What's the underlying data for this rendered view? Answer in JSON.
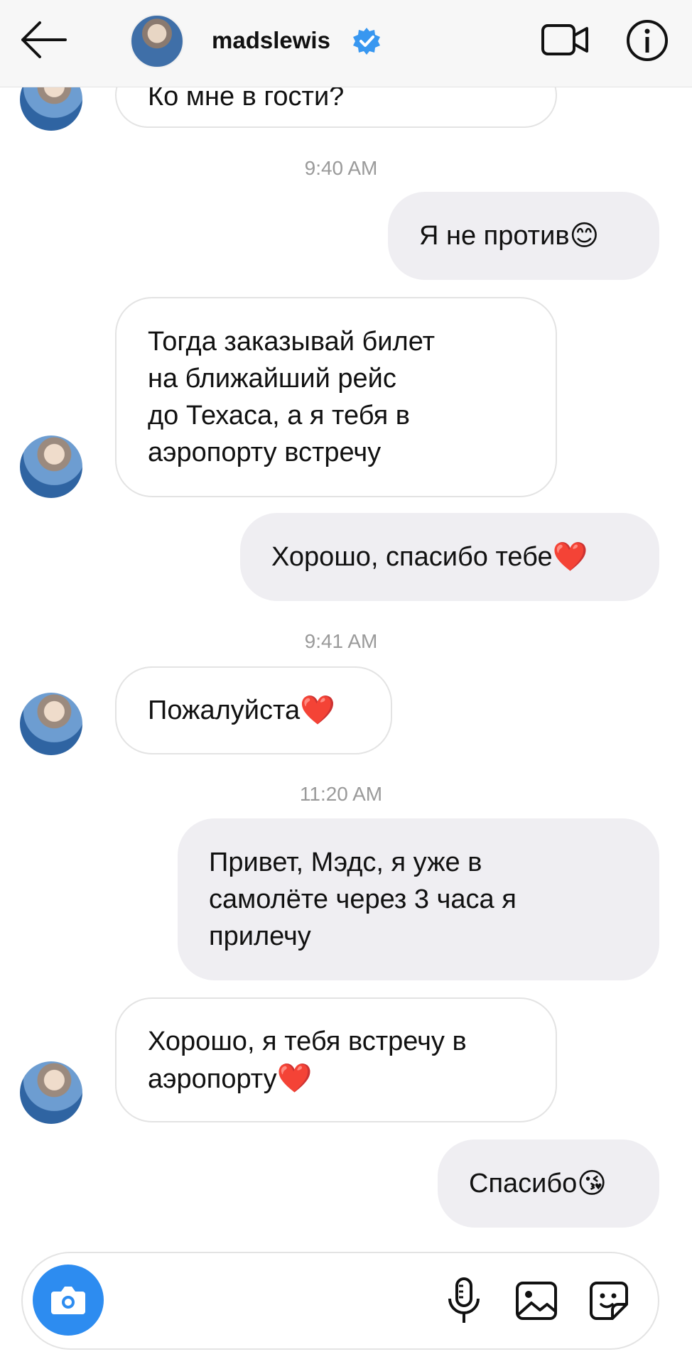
{
  "header": {
    "username": "madslewis",
    "icons": {
      "back": "back-arrow-icon",
      "verified": "verified-badge-icon",
      "video": "video-call-icon",
      "info": "info-icon"
    }
  },
  "messages": [
    {
      "kind": "received",
      "text_line1": "Ко мне в гости?"
    },
    {
      "kind": "timestamp",
      "text": "9:40 AM"
    },
    {
      "kind": "sent",
      "text": "Я не против",
      "emoji": "😊"
    },
    {
      "kind": "received",
      "lines": [
        "Тогда заказывай билет",
        "на ближайший рейс",
        "до Техаса, а я тебя в",
        "аэропорту встречу"
      ]
    },
    {
      "kind": "sent",
      "text": "Хорошо, спасибо тебе",
      "emoji": "❤️"
    },
    {
      "kind": "timestamp",
      "text": "9:41 AM"
    },
    {
      "kind": "received",
      "text": "Пожалуйста",
      "emoji": "❤️"
    },
    {
      "kind": "timestamp",
      "text": "11:20 AM"
    },
    {
      "kind": "sent",
      "lines": [
        "Привет, Мэдс, я уже в",
        "самолёте через 3 часа я",
        "прилечу"
      ]
    },
    {
      "kind": "received",
      "lines": [
        "Хорошо, я тебя встречу в",
        "аэропорту"
      ],
      "emoji": "❤️"
    },
    {
      "kind": "sent",
      "text": "Спасибо",
      "emoji": "😘"
    }
  ],
  "composer": {
    "placeholder": "",
    "icons": {
      "camera": "camera-icon",
      "mic": "microphone-icon",
      "gallery": "gallery-icon",
      "sticker": "sticker-icon"
    }
  },
  "colors": {
    "camera_button": "#2d8cf0",
    "verified": "#3897f0",
    "sent_bubble": "#efeef2"
  }
}
